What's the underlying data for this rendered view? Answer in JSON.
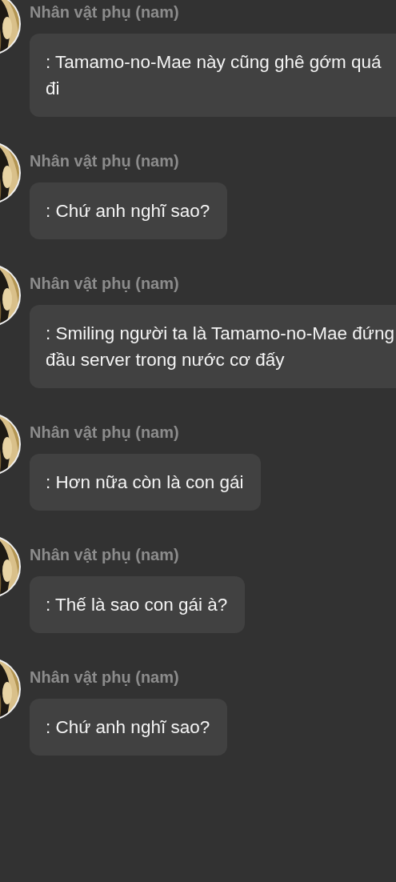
{
  "messages": [
    {
      "sender": "Nhân vật phụ (nam)",
      "text": ": Tamamo-no-Mae này cũng ghê gớm quá đi"
    },
    {
      "sender": "Nhân vật phụ (nam)",
      "text": ": Chứ anh nghĩ sao?"
    },
    {
      "sender": "Nhân vật phụ (nam)",
      "text": ": Smiling người ta là Tamamo-no-Mae đứng đầu server trong nước cơ đấy"
    },
    {
      "sender": "Nhân vật phụ (nam)",
      "text": ": Hơn nữa còn là con gái"
    },
    {
      "sender": "Nhân vật phụ (nam)",
      "text": ": Thế là sao con gái à?"
    },
    {
      "sender": "Nhân vật phụ (nam)",
      "text": ": Chứ anh nghĩ sao?"
    }
  ]
}
